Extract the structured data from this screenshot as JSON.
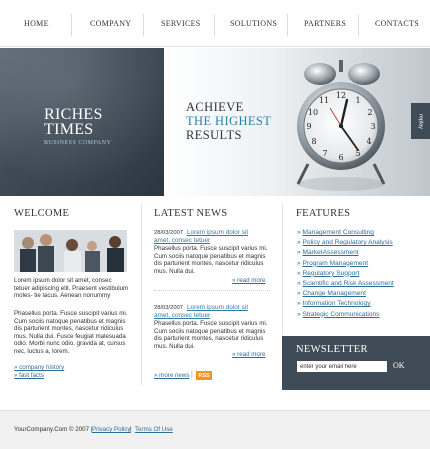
{
  "nav": {
    "items": [
      "HOME",
      "COMPANY",
      "SERVICES",
      "SOLUTIONS",
      "PARTNERS",
      "CONTACTS"
    ]
  },
  "logo": {
    "line1": "RICHES",
    "line2": "TIMES",
    "subtitle": "BUSINESS COMPANY"
  },
  "hero": {
    "tagline1": "ACHIEVE",
    "tagline2": "THE HIGHEST",
    "tagline3": "RESULTS",
    "replay": "replay"
  },
  "welcome": {
    "title": "WELCOME",
    "para1": "Lorem ipsum dolor sit amet, consec tetuer adipiscing elit. Praesent vestibulum moles- tie lacus. Aenean nonummy",
    "para2": "Phasellus porta. Fusce suscipit varius mi. Cum sociis natoque penatibus et magnis dis parturient montes, nascetur ridiculus mus. Nulla dui. Fusce feugiat malesuada odio. Morbi nunc odio, gravida at, cursus nec, luctus a, lorem.",
    "links": [
      "company history",
      "fast facts"
    ]
  },
  "news": {
    "title": "LATEST NEWS",
    "items": [
      {
        "date": "28/03/2007",
        "headline_a": "Lorem ipsum dolor sit",
        "headline_b": "amet, consec tetuer",
        "body": "Phasellus porta. Fusce suscipit varius mi. Cum sociis natoque penatibus et magnis dis parturient montes, nascetur ridiculus mus. Nulla dui.",
        "read_more": "read more"
      },
      {
        "date": "28/03/2007",
        "headline_a": "Lorem ipsum dolor sit",
        "headline_b": "amet, consec tetuer",
        "body": "Phasellus porta. Fusce suscipit varius mi. Cum sociis natoque penatibus et magnis dis parturient montes, nascetur ridiculus mus. Nulla dui.",
        "read_more": "read more"
      }
    ],
    "more_news": "more news",
    "rss": "RSS"
  },
  "features": {
    "title": "FEATURES",
    "items": [
      "Management Consulting",
      "Policy and Regulatory Analysis",
      "MarketAssessment",
      "Program Management",
      "Regulatory Support",
      "Scientific and Risk Assessment",
      "Change Management",
      "Information Technology",
      "Strategic Communications"
    ]
  },
  "newsletter": {
    "title": "NEWSLETTER",
    "input_value": "enter your email here",
    "ok": "OK"
  },
  "footer": {
    "copyright": "YourCompany.Com © 2007  |",
    "privacy": "Privacy Policy",
    "sep": "|",
    "terms": "Terms Of Use"
  },
  "colors": {
    "accent_blue": "#2e7fa6",
    "dark_slate": "#3f4c58",
    "rss_orange": "#f7931e"
  }
}
